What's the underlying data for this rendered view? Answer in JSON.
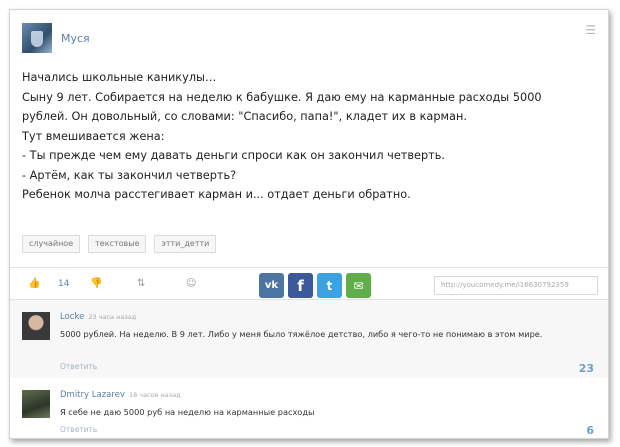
{
  "post": {
    "author": "Муся",
    "menu_icon": "☰",
    "lines": [
      "Начались школьные каникулы…",
      "Сыну 9 лет. Собирается на неделю к бабушке. Я даю ему на карманные расходы 5000",
      "рублей. Он довольный, со словами: \"Спасибо, папа!\", кладет их в карман.",
      "Тут вмешивается жена:",
      "- Ты прежде чем ему давать деньги спроси как он закончил четверть.",
      "- Артём, как ты закончил четверть?",
      "Ребенок молча расстегивает карман и... отдает деньги обратно."
    ],
    "tags": [
      "случайное",
      "текстовые",
      "этти_детти"
    ]
  },
  "actions": {
    "like_icon": "thumbs-up-icon",
    "like_glyph": "👍",
    "like_count": "14",
    "dislike_glyph": "👎",
    "repost_glyph": "⇅",
    "fav_glyph": "☺",
    "share": {
      "vk": "vk",
      "fb": "f",
      "tw": "t",
      "mail": "✉"
    },
    "url": "http://youcomedy.me/i16630792359",
    "colors": {
      "vk": "#4c75a3",
      "fb": "#3b5998",
      "tw": "#3aa3e0",
      "mail": "#5fae4a"
    }
  },
  "comments": [
    {
      "author": "Locke",
      "time": "23 часа назад",
      "text": "5000 рублей. На неделю. В 9 лет. Либо у меня было тяжёлое детство, либо я чего-то не понимаю в этом мире.",
      "reply": "Ответить",
      "rating": "23"
    },
    {
      "author": "Dmitry Lazarev",
      "time": "18 часов назад",
      "text": "Я себе не даю 5000 руб на неделю на карманные расходы",
      "reply": "Ответить",
      "rating": "6"
    }
  ]
}
